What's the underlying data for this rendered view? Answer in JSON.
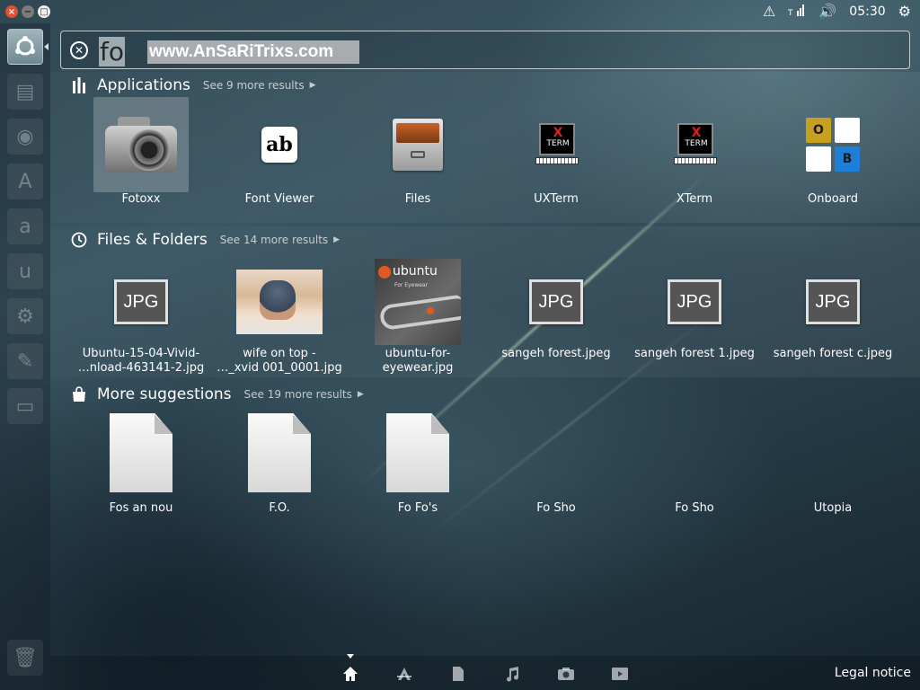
{
  "panel": {
    "window_buttons": {
      "close": "×",
      "minimize": "−",
      "maximize": "□"
    },
    "clock": "05:30",
    "indicator_icons": [
      "warning-icon",
      "network-icon",
      "volume-icon",
      "gear-icon"
    ]
  },
  "launcher": {
    "items": [
      "dash-home",
      "files",
      "firefox",
      "software-center",
      "amazon",
      "ubuntu-one",
      "system-settings",
      "text-editor",
      "removable-drive",
      "trash"
    ],
    "amazon_letter": "a",
    "ubuntu_letter": "u"
  },
  "search": {
    "query": "fo",
    "watermark": "www.AnSaRiTrixs.com"
  },
  "categories": {
    "applications": {
      "title": "Applications",
      "more": "See 9 more results"
    },
    "files_folders": {
      "title": "Files & Folders",
      "more": "See 14 more results"
    },
    "suggestions": {
      "title": "More suggestions",
      "more": "See 19 more results"
    }
  },
  "applications": [
    {
      "label": "Fotoxx"
    },
    {
      "label": "Font Viewer",
      "glyph": "ab"
    },
    {
      "label": "Files"
    },
    {
      "label": "UXTerm",
      "term_text": "TERM"
    },
    {
      "label": "XTerm",
      "term_text": "TERM"
    },
    {
      "label": "Onboard",
      "keys": [
        "O",
        "",
        "",
        "B"
      ]
    }
  ],
  "files": [
    {
      "line1": "Ubuntu-15-04-Vivid-",
      "line2": "…nload-463141-2.jpg",
      "badge": "JPG"
    },
    {
      "line1": "wife on top -",
      "line2": "…_xvid 001_0001.jpg"
    },
    {
      "line1": "ubuntu-for-",
      "line2": "eyewear.jpg",
      "card_word": "ubuntu",
      "card_sub": "For Eyewear"
    },
    {
      "line1": "sangeh forest.jpeg",
      "line2": "",
      "badge": "JPG"
    },
    {
      "line1": "sangeh forest 1.jpeg",
      "line2": "",
      "badge": "JPG"
    },
    {
      "line1": "sangeh forest c.jpeg",
      "line2": "",
      "badge": "JPG"
    }
  ],
  "suggestions": [
    {
      "label": "Fos an nou"
    },
    {
      "label": "F.O."
    },
    {
      "label": "Fo Fo's"
    },
    {
      "label": "Fo Sho"
    },
    {
      "label": "Fo Sho"
    },
    {
      "label": "Utopia"
    }
  ],
  "filter_bar": {
    "lenses": [
      "home-icon",
      "applications-icon",
      "files-icon",
      "music-icon",
      "photos-icon",
      "video-icon"
    ],
    "legal": "Legal notice"
  },
  "colors": {
    "accent_orange": "#e0502a",
    "onboard_o": "#c8a020",
    "onboard_b": "#1e7fd8"
  }
}
